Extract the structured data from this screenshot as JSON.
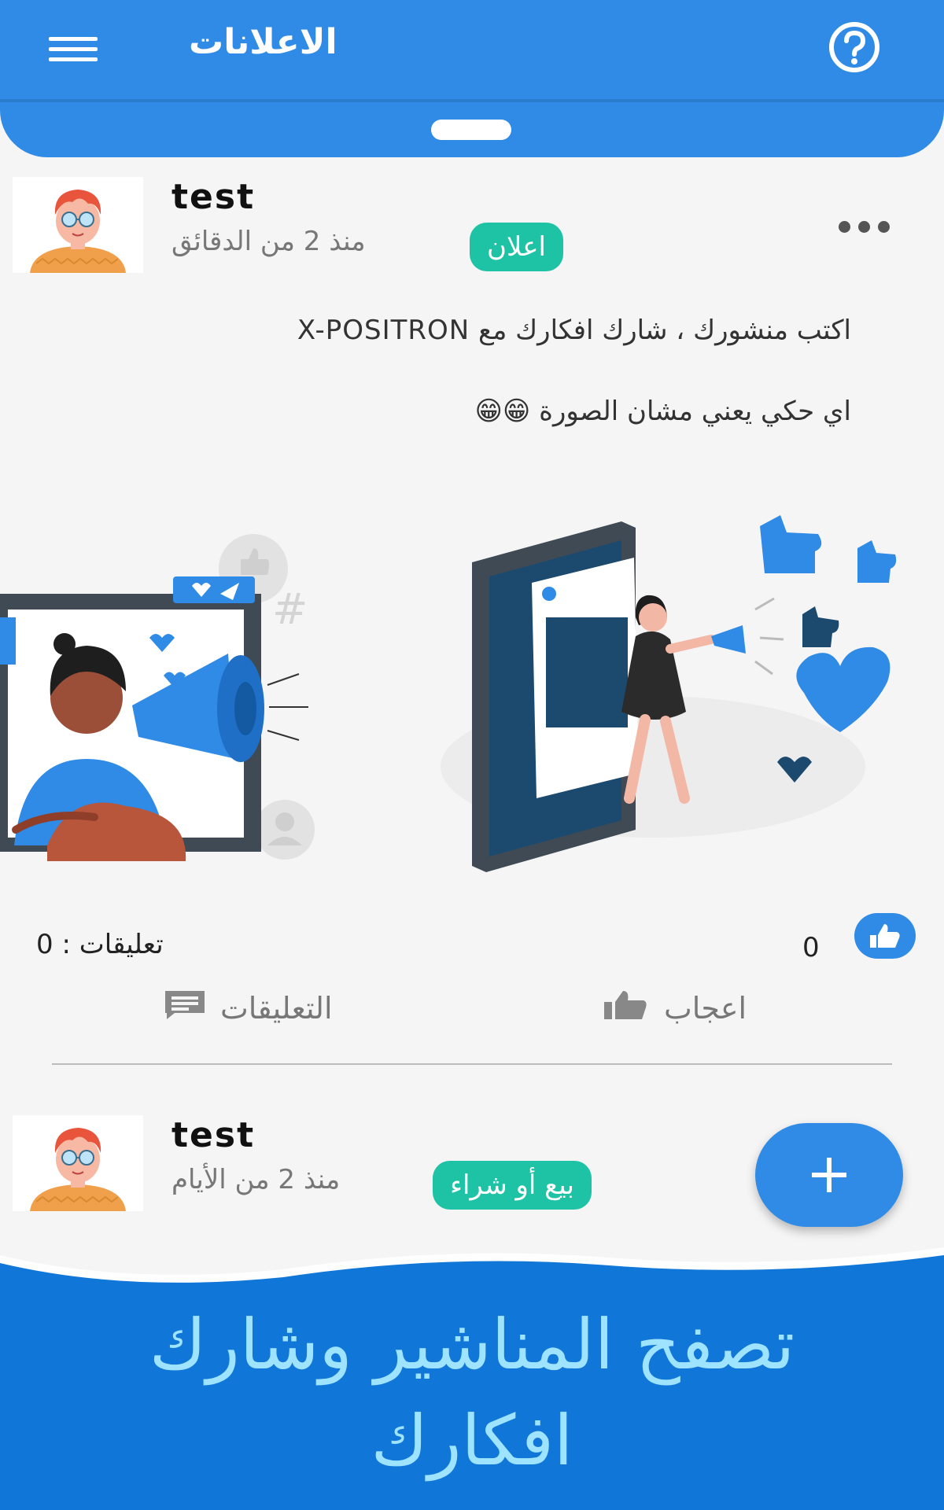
{
  "appbar": {
    "title": "الاعلانات",
    "menu_icon": "hamburger-menu-icon",
    "help_icon": "help-circle-icon",
    "color": "#2f8be5"
  },
  "posts": [
    {
      "author": "test",
      "time": "منذ 2 من الدقائق",
      "badge": "اعلان",
      "text_lines": [
        "اكتب منشورك ، شارك افكارك مع X-POSITRON",
        "اي حكي يعني مشان الصورة 😁😁"
      ],
      "likes": "0",
      "comments_label": "تعليقات : 0",
      "like_action": "اعجاب",
      "comment_action": "التعليقات"
    },
    {
      "author": "test",
      "time": "منذ 2 من الأيام",
      "badge": "بيع أو شراء"
    }
  ],
  "fab": {
    "icon": "plus-icon"
  },
  "banner": {
    "line1": "تصفح المناشير وشارك",
    "line2": "افكارك"
  },
  "colors": {
    "primary": "#2f8be5",
    "badge": "#1ec2a4",
    "banner_text": "#9ee3ff"
  }
}
